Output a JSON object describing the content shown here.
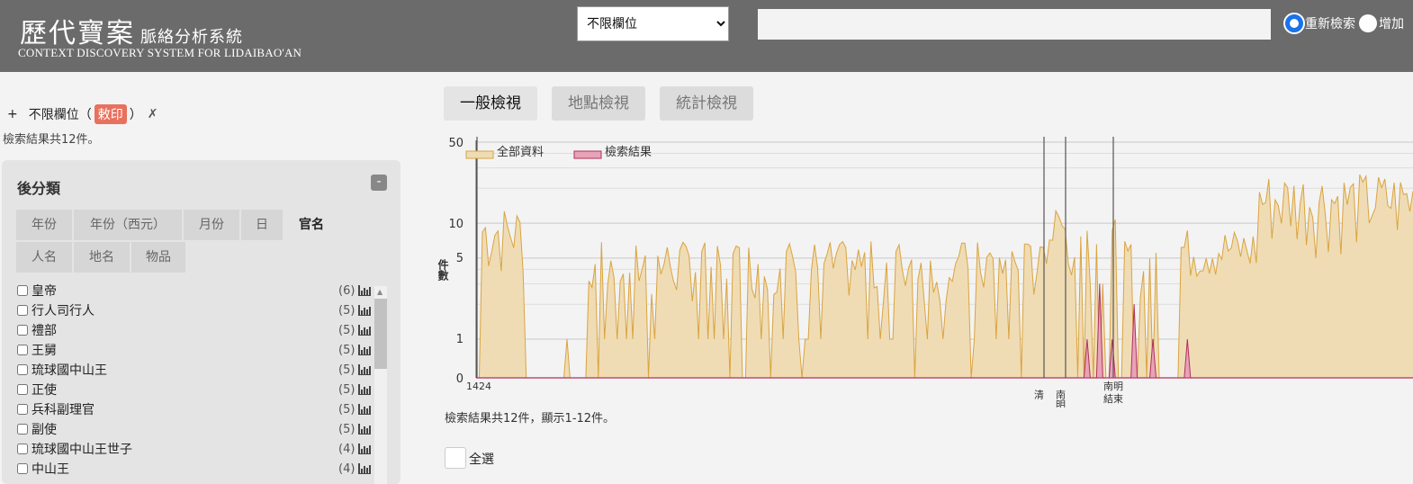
{
  "header": {
    "logo_cn": "歷代寶案",
    "logo_cn_sub": "脈絡分析系統",
    "logo_en": "CONTEXT DISCOVERY SYSTEM FOR LIDAIBAO'AN",
    "field_select": {
      "selected": "不限欄位"
    },
    "search": {
      "value": ""
    },
    "radio_new": "重新檢索",
    "radio_add": "增加"
  },
  "query": {
    "add": "+",
    "field": "不限欄位",
    "open_paren": "（",
    "term": "敕印",
    "close_paren": "）",
    "remove": "✗",
    "count_text": "檢索結果共12件。"
  },
  "facets": {
    "title": "後分類",
    "collapse": "-",
    "tabs": [
      "年份",
      "年份（西元）",
      "月份",
      "日",
      "官名",
      "人名",
      "地名",
      "物品"
    ],
    "active_tab": "官名",
    "items": [
      {
        "label": "皇帝",
        "count": "(6)"
      },
      {
        "label": "行人司行人",
        "count": "(5)"
      },
      {
        "label": "禮部",
        "count": "(5)"
      },
      {
        "label": "王舅",
        "count": "(5)"
      },
      {
        "label": "琉球國中山王",
        "count": "(5)"
      },
      {
        "label": "正使",
        "count": "(5)"
      },
      {
        "label": "兵科副理官",
        "count": "(5)"
      },
      {
        "label": "副使",
        "count": "(5)"
      },
      {
        "label": "琉球國中山王世子",
        "count": "(4)"
      },
      {
        "label": "中山王",
        "count": "(4)"
      }
    ]
  },
  "view_tabs": [
    "一般檢視",
    "地點檢視",
    "統計檢視"
  ],
  "chart_data": {
    "type": "area",
    "ylabel": "件數",
    "yscale": "log",
    "yticks": [
      "50",
      "10",
      "5",
      "1",
      "0"
    ],
    "legend": [
      "全部資料",
      "檢索結果"
    ],
    "colors": {
      "all": "#f0dcb4",
      "all_line": "#d9a441",
      "hits": "#e8a3b7",
      "hits_line": "#b03060"
    },
    "x_start_label": "1424",
    "event_labels": [
      "清",
      "南明",
      "南明結束"
    ],
    "hits": [
      {
        "index": 195,
        "value": 1
      },
      {
        "index": 199,
        "value": 3
      },
      {
        "index": 203,
        "value": 1
      },
      {
        "index": 210,
        "value": 2
      },
      {
        "index": 216,
        "value": 1
      },
      {
        "index": 227,
        "value": 1
      }
    ]
  },
  "results": {
    "summary": "檢索結果共12件，顯示1-12件。",
    "select_all": "全選"
  }
}
